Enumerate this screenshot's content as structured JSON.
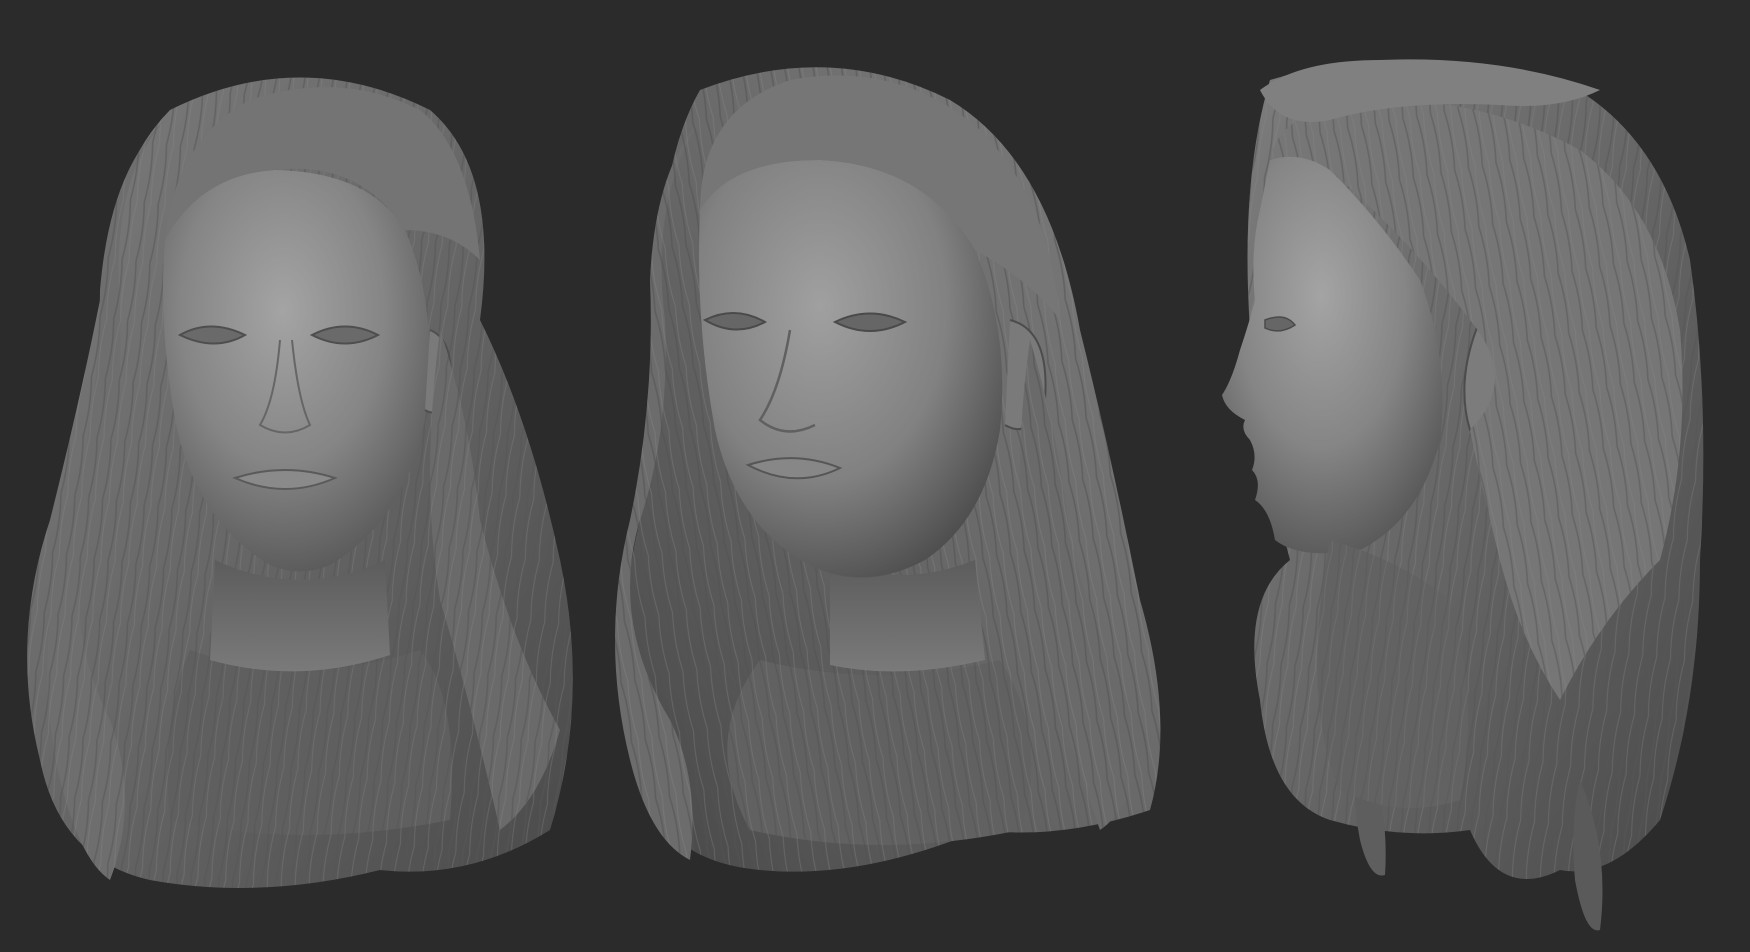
{
  "scene": {
    "background_color": "#2b2b2b",
    "material_color": "#7a7a7a",
    "views": [
      {
        "name": "front",
        "description_icon": "head-sculpt-front"
      },
      {
        "name": "three-quarter",
        "description_icon": "head-sculpt-three-quarter"
      },
      {
        "name": "side",
        "description_icon": "head-sculpt-profile"
      }
    ]
  }
}
